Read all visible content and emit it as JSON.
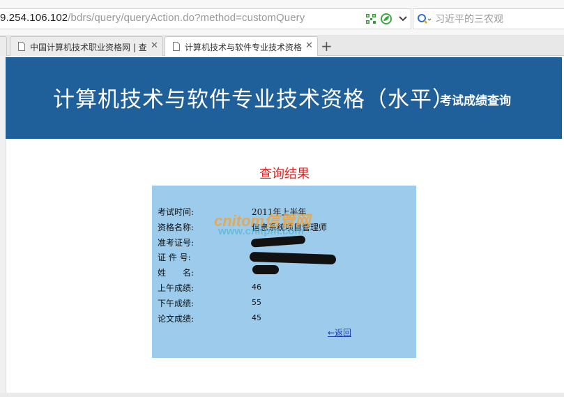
{
  "browser": {
    "url_host": "9.254.106.102",
    "url_path": "/bdrs/query/queryAction.do?method=customQuery",
    "search_placeholder": "习近平的三农观",
    "tabs": [
      {
        "title": "中国计算机技术职业资格网 | 查"
      },
      {
        "title": "计算机技术与软件专业技术资格"
      }
    ],
    "close_glyph": "✕",
    "new_tab_glyph": "+"
  },
  "banner": {
    "title": "计算机技术与软件专业技术资格（水平）",
    "subtitle": "考试成绩查询",
    "color": "#20609a"
  },
  "result": {
    "heading": "查询结果",
    "rows": [
      {
        "label": "考试时间:",
        "value": "2011年上半年"
      },
      {
        "label": "资格名称:",
        "value": "信息系统项目管理师"
      },
      {
        "label": "准考证号:",
        "value": ""
      },
      {
        "label": "证 件 号:",
        "value": ""
      },
      {
        "label": "姓　　名:",
        "value": ""
      },
      {
        "label": "上午成绩:",
        "value": "46"
      },
      {
        "label": "下午成绩:",
        "value": "55"
      },
      {
        "label": "论文成绩:",
        "value": "45"
      }
    ],
    "back_link": "←返回",
    "card_color": "#9ccbeb"
  },
  "watermark": {
    "line1": "cnitom信管网",
    "line2": "www.cnitpm.com"
  }
}
